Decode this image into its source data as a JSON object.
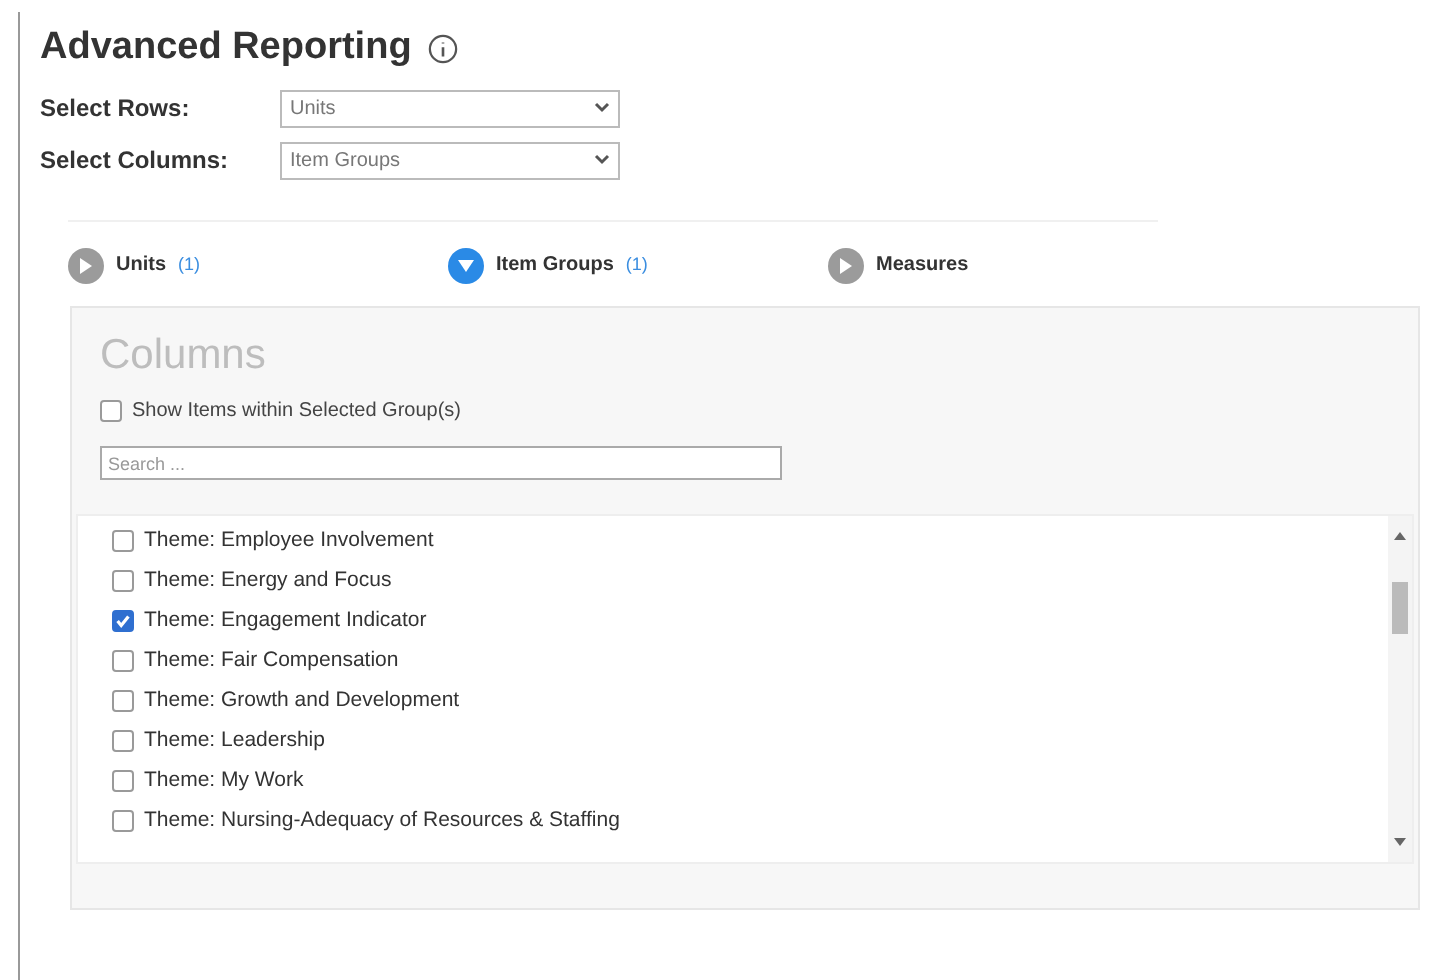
{
  "title": "Advanced Reporting",
  "selects": [
    {
      "label": "Select Rows:",
      "value": "Units"
    },
    {
      "label": "Select Columns:",
      "value": "Item Groups"
    }
  ],
  "tabs": [
    {
      "label": "Units",
      "count": "(1)",
      "selected": false
    },
    {
      "label": "Item Groups",
      "count": "(1)",
      "selected": true
    },
    {
      "label": "Measures",
      "selected": false
    }
  ],
  "panel": {
    "heading": "Columns",
    "show_items": {
      "label": "Show Items within Selected Group(s)",
      "checked": false
    },
    "search": {
      "placeholder": "Search ..."
    },
    "items": [
      {
        "label": "Theme: Employee Involvement",
        "checked": false
      },
      {
        "label": "Theme: Energy and Focus",
        "checked": false
      },
      {
        "label": "Theme: Engagement Indicator",
        "checked": true
      },
      {
        "label": "Theme: Fair Compensation",
        "checked": false
      },
      {
        "label": "Theme: Growth and Development",
        "checked": false
      },
      {
        "label": "Theme: Leadership",
        "checked": false
      },
      {
        "label": "Theme: My Work",
        "checked": false
      },
      {
        "label": "Theme: Nursing-Adequacy of Resources & Staffing",
        "checked": false
      }
    ]
  }
}
